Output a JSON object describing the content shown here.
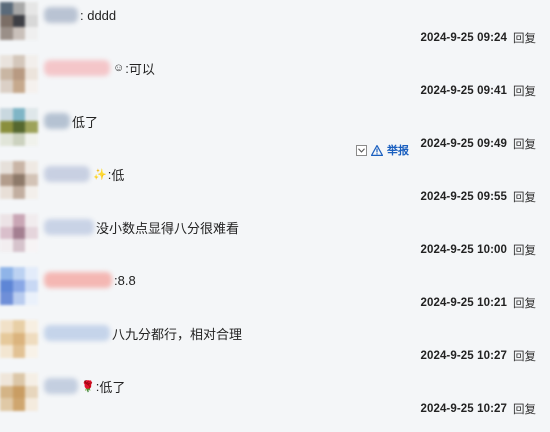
{
  "comments": [
    {
      "content": ": dddd",
      "time": "2024-9-25 09:24",
      "reply": "回复",
      "avatar_colors": [
        "#5a6a7a",
        "#a8a8a8",
        "#e6e6e6",
        "#7b6e66",
        "#3e3f45",
        "#d8d8d8",
        "#9a8f88",
        "#c9c0ba",
        "#efefef"
      ],
      "name_blur_color": "#b9c3d3"
    },
    {
      "content": "可以",
      "emoji": "☺",
      "time": "2024-9-25 09:41",
      "reply": "回复",
      "avatar_colors": [
        "#e9e3dd",
        "#d4c7bb",
        "#f2efec",
        "#c9b6a3",
        "#b89a82",
        "#ece4dc",
        "#dbd0c6",
        "#c6a98d",
        "#f5f1ee"
      ],
      "name_blur_color": "#f4c6c9"
    },
    {
      "content": "低了",
      "time": "2024-9-25 09:49",
      "reply": "回复",
      "avatar_colors": [
        "#c9d8df",
        "#7fb5c6",
        "#dfe7ea",
        "#8a8f3d",
        "#55682f",
        "#9da25a",
        "#e1e5d9",
        "#ccd2bf",
        "#f0f2ec"
      ],
      "name_blur_color": "#b5c2d2",
      "report_label": "举报"
    },
    {
      "content": "低",
      "emoji": "✨",
      "time": "2024-9-25 09:55",
      "reply": "回复",
      "avatar_colors": [
        "#e6e0da",
        "#c9b5a6",
        "#efe9e3",
        "#b39d8c",
        "#8e7a6a",
        "#d3c3b6",
        "#e8dfd7",
        "#c2aea0",
        "#f3efeb"
      ],
      "name_blur_color": "#c8d0e2"
    },
    {
      "content": "没小数点显得八分很难看",
      "time": "2024-9-25 10:00",
      "reply": "回复",
      "avatar_colors": [
        "#ece3e6",
        "#c9a6b5",
        "#f1ecee",
        "#d9bfcb",
        "#a47f91",
        "#e5d5dc",
        "#f2eef0",
        "#d6c3cc",
        "#f7f4f5"
      ],
      "name_blur_color": "#c9d3e6"
    },
    {
      "content": "8.8",
      "time": "2024-9-25 10:21",
      "reply": "回复",
      "avatar_colors": [
        "#8fb4e8",
        "#bcd2f2",
        "#e3ecfa",
        "#5e86d6",
        "#8aa8e6",
        "#c8d8f4",
        "#6f8fd8",
        "#b9ccef",
        "#eaf1fb"
      ],
      "name_blur_color": "#f4b7b3"
    },
    {
      "content": "八九分都行，相对合理",
      "time": "2024-9-25 10:27",
      "reply": "回复",
      "avatar_colors": [
        "#f1e1c8",
        "#e8cfa6",
        "#f7efe2",
        "#e6c99b",
        "#dbb47e",
        "#efdcbf",
        "#f3e6d1",
        "#e2c294",
        "#f8f2e8"
      ],
      "name_blur_color": "#c5d4ea"
    },
    {
      "content": "低了",
      "emoji": "🌹",
      "time": "2024-9-25 10:27",
      "reply": "回复",
      "avatar_colors": [
        "#efe6da",
        "#dcc7a8",
        "#f5efe6",
        "#d4b486",
        "#c99d63",
        "#e7d6bd",
        "#e0c9a6",
        "#cfa66f",
        "#f4ebde"
      ],
      "name_blur_color": "#c4cfe0"
    }
  ]
}
